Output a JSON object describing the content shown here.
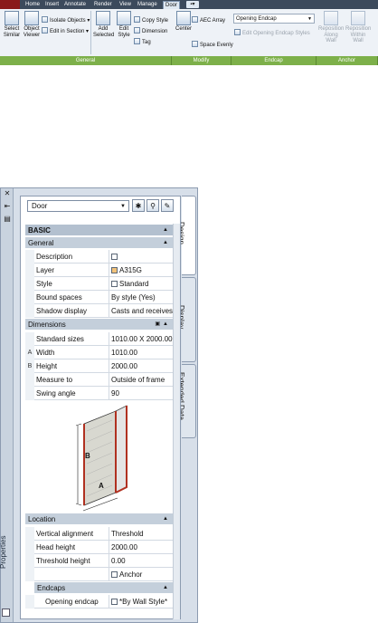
{
  "ribbon": {
    "tabs": [
      "Home",
      "Insert",
      "Annotate",
      "Render",
      "View",
      "Manage",
      "Door"
    ],
    "active_tab": "Door",
    "panels": {
      "general": {
        "title": "General",
        "select_similar": "Select Similar",
        "object_viewer": "Object Viewer",
        "isolate_objects": "Isolate Objects",
        "edit_in_section": "Edit in Section",
        "add_selected": "Add Selected",
        "edit_style": "Edit Style",
        "copy_style": "Copy Style",
        "dimension": "Dimension",
        "tag": "Tag"
      },
      "modify": {
        "title": "Modify",
        "center": "Center",
        "aec_array": "AEC Array",
        "space_evenly": "Space Evenly"
      },
      "endcap": {
        "title": "Endcap",
        "select_value": "Opening Endcap",
        "edit_opening_endcap_styles": "Edit Opening Endcap Styles"
      },
      "anchor": {
        "title": "Anchor",
        "reposition_along_wall": "Reposition Along Wall",
        "reposition_within_wall": "Reposition Within Wall"
      }
    }
  },
  "palette": {
    "strip_title": "Properties",
    "object_type": "Door",
    "side_tabs": [
      "Design",
      "Display",
      "Extended Data"
    ],
    "basic_label": "BASIC",
    "general": {
      "title": "General",
      "rows": [
        {
          "label": "Description",
          "value": ""
        },
        {
          "label": "Layer",
          "value": "A315G"
        },
        {
          "label": "Style",
          "value": "Standard"
        },
        {
          "label": "Bound spaces",
          "value": "By style (Yes)"
        },
        {
          "label": "Shadow display",
          "value": "Casts and receives ..."
        }
      ]
    },
    "dimensions": {
      "title": "Dimensions",
      "rows": [
        {
          "marker": "",
          "label": "Standard sizes",
          "value": "1010.00  X  2000.00..."
        },
        {
          "marker": "A",
          "label": "Width",
          "value": "1010.00"
        },
        {
          "marker": "B",
          "label": "Height",
          "value": "2000.00"
        },
        {
          "marker": "",
          "label": "Measure to",
          "value": "Outside of frame"
        },
        {
          "marker": "",
          "label": "Swing angle",
          "value": "90"
        }
      ],
      "diagram_labels": {
        "a": "A",
        "b": "B"
      }
    },
    "location": {
      "title": "Location",
      "rows": [
        {
          "label": "Vertical alignment",
          "value": "Threshold"
        },
        {
          "label": "Head height",
          "value": "2000.00"
        },
        {
          "label": "Threshold height",
          "value": "0.00"
        },
        {
          "label": "",
          "value": "Anchor"
        }
      ]
    },
    "endcaps": {
      "title": "Endcaps",
      "rows": [
        {
          "label": "Opening endcap",
          "value": "*By Wall Style*"
        }
      ]
    }
  }
}
